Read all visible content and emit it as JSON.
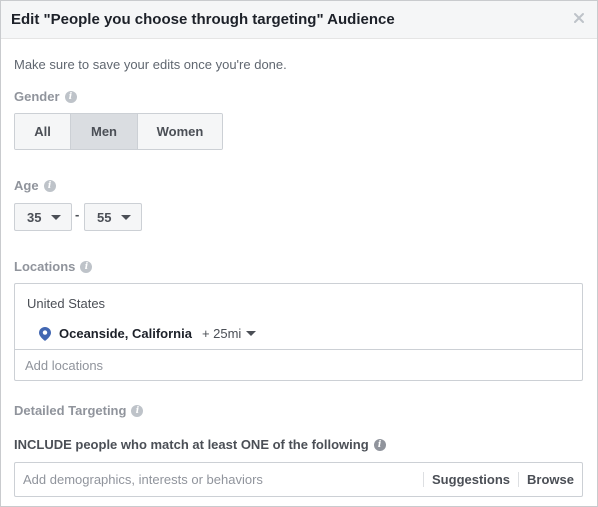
{
  "dialog": {
    "title": "Edit \"People you choose through targeting\" Audience",
    "close_icon": "close-icon"
  },
  "hint": "Make sure to save your edits once you're done.",
  "gender": {
    "label": "Gender",
    "options": [
      "All",
      "Men",
      "Women"
    ],
    "selected": "Men"
  },
  "age": {
    "label": "Age",
    "min": "35",
    "separator": "-",
    "max": "55"
  },
  "locations": {
    "label": "Locations",
    "country": "United States",
    "city": "Oceanside, California",
    "radius": "+ 25mi",
    "placeholder": "Add locations"
  },
  "detailed_targeting": {
    "label": "Detailed Targeting",
    "include_label": "INCLUDE people who match at least ONE of the following",
    "placeholder": "Add demographics, interests or behaviors",
    "suggestions": "Suggestions",
    "browse": "Browse"
  },
  "colors": {
    "pin": "#4267b2",
    "selected_bg": "#dadde1"
  }
}
